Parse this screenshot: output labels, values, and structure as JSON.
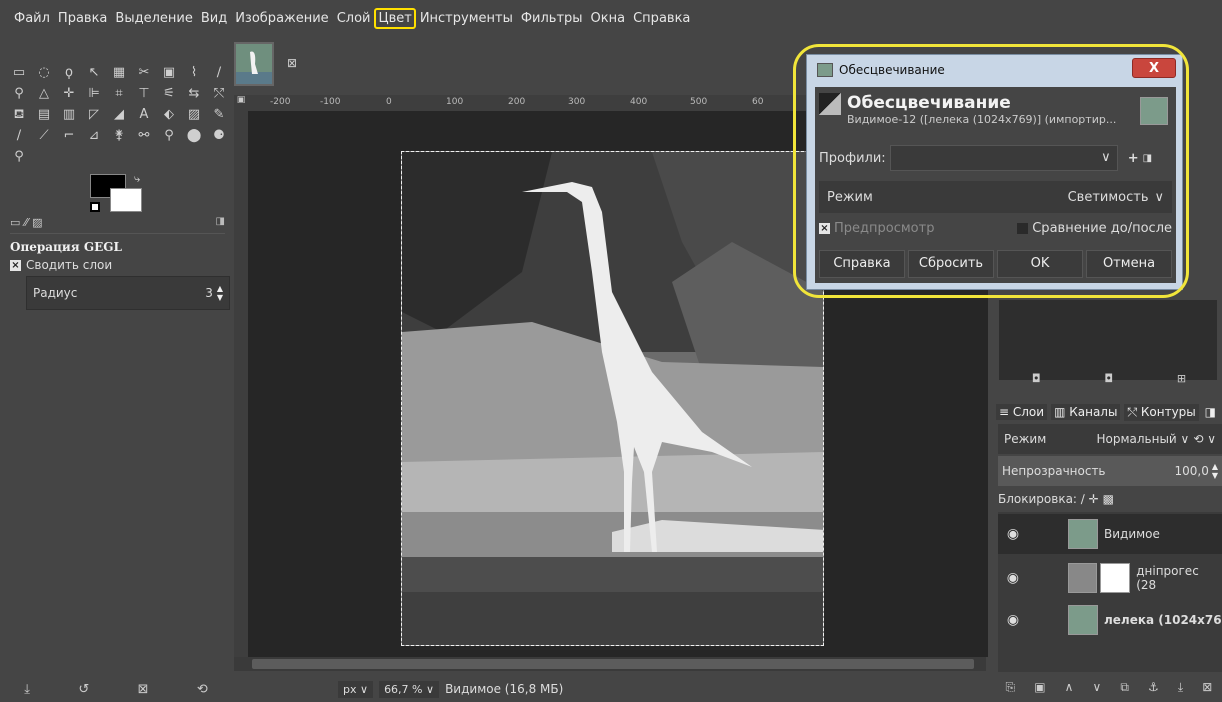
{
  "menu": [
    "Файл",
    "Правка",
    "Выделение",
    "Вид",
    "Изображение",
    "Слой",
    "Цвет",
    "Инструменты",
    "Фильтры",
    "Окна",
    "Справка"
  ],
  "highlight_color": "#ffe000",
  "tool_options": {
    "title": "Операция GEGL",
    "merge_label": "Сводить слои",
    "radius_label": "Радиус",
    "radius_value": "3"
  },
  "ruler": {
    "corner": "▣",
    "ticks": [
      "-200",
      "-100",
      "0",
      "100",
      "200",
      "300",
      "400",
      "500",
      "60"
    ]
  },
  "status": {
    "unit": "px",
    "zoom": "66,7 %",
    "info": "Видимое (16,8 МБ)"
  },
  "dialog": {
    "window_title": "Обесцвечивание",
    "close_label": "X",
    "heading": "Обесцвечивание",
    "subtitle": "Видимое-12 ([лелека (1024x769)] (импортир...",
    "profiles_label": "Профили:",
    "mode_label": "Режим",
    "mode_value": "Светимость",
    "preview_label": "Предпросмотр",
    "compare_label": "Сравнение до/после",
    "buttons": [
      "Справка",
      "Сбросить",
      "OK",
      "Отмена"
    ]
  },
  "layers_panel": {
    "tabs": [
      "Слои",
      "Каналы",
      "Контуры"
    ],
    "mode_label": "Режим",
    "mode_value": "Нормальный",
    "opacity_label": "Непрозрачность",
    "opacity_value": "100,0",
    "lock_label": "Блокировка:",
    "layers": [
      {
        "name": "Видимое"
      },
      {
        "name": "дніпрогес (28"
      },
      {
        "name": "лелека (1024x76"
      }
    ]
  }
}
